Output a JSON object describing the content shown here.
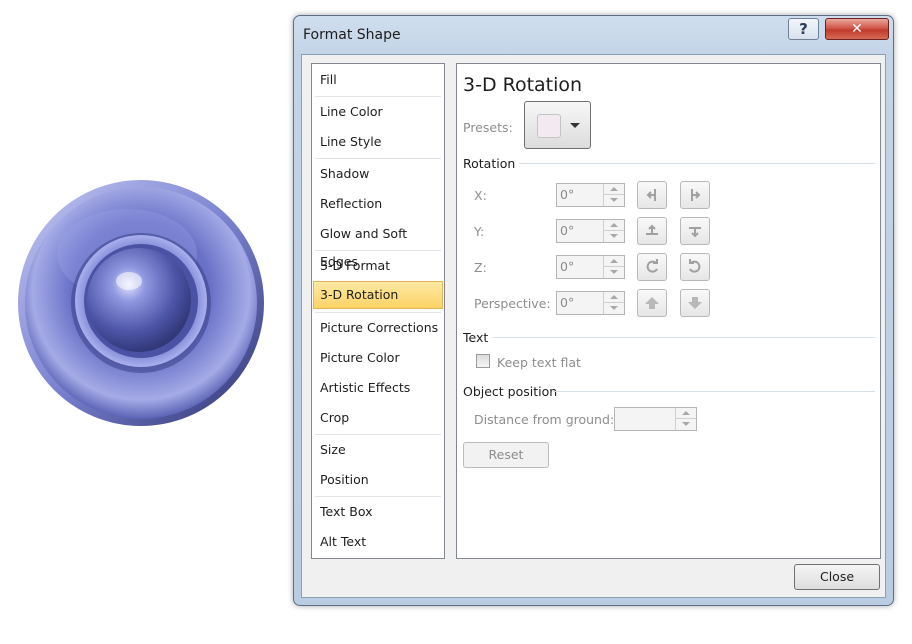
{
  "dialog": {
    "title": "Format Shape",
    "help_glyph": "?",
    "close_glyph": "✕",
    "close_button": "Close"
  },
  "nav": {
    "selected": "3-D Rotation",
    "items": [
      {
        "label": "Fill"
      },
      {
        "label": "Line Color"
      },
      {
        "label": "Line Style"
      },
      {
        "label": "Shadow"
      },
      {
        "label": "Reflection"
      },
      {
        "label": "Glow and Soft Edges"
      },
      {
        "label": "3-D Format"
      },
      {
        "label": "3-D Rotation"
      },
      {
        "label": "Picture Corrections"
      },
      {
        "label": "Picture Color"
      },
      {
        "label": "Artistic Effects"
      },
      {
        "label": "Crop"
      },
      {
        "label": "Size"
      },
      {
        "label": "Position"
      },
      {
        "label": "Text Box"
      },
      {
        "label": "Alt Text"
      }
    ]
  },
  "pane": {
    "title": "3-D Rotation",
    "presets_label": "Presets:",
    "rotation": {
      "section": "Rotation",
      "x_label": "X:",
      "x_value": "0°",
      "y_label": "Y:",
      "y_value": "0°",
      "z_label": "Z:",
      "z_value": "0°",
      "perspective_label": "Perspective:",
      "perspective_value": "0°"
    },
    "text": {
      "section": "Text",
      "keep_flat_label": "Keep text flat",
      "keep_flat_checked": false
    },
    "object_position": {
      "section": "Object position",
      "distance_label": "Distance from ground:",
      "distance_value": ""
    },
    "reset_label": "Reset"
  },
  "colors": {
    "selected_item": "#fcd366",
    "shape_primary": "#6b74c9",
    "close_red": "#c03a2c"
  },
  "icons": {
    "shape": "blue-3d-button-shape",
    "help": "question-mark-icon",
    "close": "close-x-icon",
    "rotate": [
      "rotate-left-icon",
      "rotate-right-icon",
      "rotate-up-icon",
      "rotate-down-icon",
      "rotate-counterclockwise-icon",
      "rotate-clockwise-icon",
      "perspective-increase-icon",
      "perspective-decrease-icon"
    ]
  }
}
